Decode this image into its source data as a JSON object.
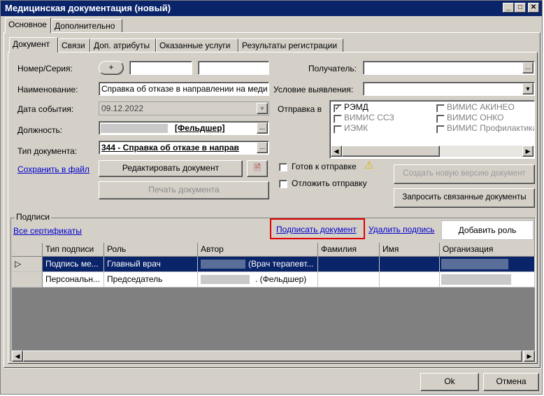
{
  "window": {
    "title": "Медицинская документация (новый)",
    "min_glyph": "_",
    "max_glyph": "□",
    "close_glyph": "✕"
  },
  "outer_tabs": [
    "Основное",
    "Дополнительно"
  ],
  "inner_tabs": [
    "Документ",
    "Связи",
    "Доп. атрибуты",
    "Оказанные услуги",
    "Результаты регистрации"
  ],
  "form": {
    "number_label": "Номер/Серия:",
    "plus_label": "+",
    "name_label": "Наименование:",
    "name_value": "Справка об отказе в направлении на меди",
    "event_date_label": "Дата события:",
    "event_date_value": "09.12.2022",
    "position_label": "Должность:",
    "position_value": "[Фельдшер]",
    "doc_type_label": "Тип документа:",
    "doc_type_value": "344 - Справка об отказе в направ",
    "recipient_label": "Получатель:",
    "condition_label": "Условие выявления:",
    "send_label": "Отправка в",
    "dots": "..."
  },
  "send_targets": [
    {
      "label": "РЭМД",
      "checked": true,
      "disabled": false
    },
    {
      "label": "ВИМИС ССЗ",
      "checked": false,
      "disabled": true
    },
    {
      "label": "ИЭМК",
      "checked": false,
      "disabled": true
    },
    {
      "label": "ВИМИС АКИНЕО",
      "checked": false,
      "disabled": true
    },
    {
      "label": "ВИМИС ОНКО",
      "checked": false,
      "disabled": true
    },
    {
      "label": "ВИМИС Профилактика",
      "checked": false,
      "disabled": true
    }
  ],
  "actions": {
    "save_to_file": "Сохранить в файл",
    "edit_document": "Редактировать документ",
    "print_document": "Печать документа",
    "ready_to_send": "Готов к отправке",
    "postpone_send": "Отложить отправку",
    "create_new_version": "Создать новую версию документ",
    "request_related": "Запросить связанные документы"
  },
  "signatures": {
    "group_label": "Подписи",
    "all_certificates": "Все сертификаты",
    "sign_document": "Подписать документ",
    "delete_signature": "Удалить подпись",
    "add_role": "Добавить роль",
    "columns": [
      "Тип подписи",
      "Роль",
      "Автор",
      "Фамилия",
      "Имя",
      "Организация"
    ],
    "rows": [
      {
        "marker": "▷",
        "type": "Подпись ме...",
        "role": "Главный врач",
        "author": "(Врач терапевт...",
        "last": "",
        "first": "",
        "org": ""
      },
      {
        "marker": "",
        "type": "Персональн...",
        "role": "Председатель",
        "author": ". (Фельдшер)",
        "last": "",
        "first": "",
        "org": ""
      }
    ]
  },
  "footer": {
    "ok": "Ok",
    "cancel": "Отмена"
  },
  "colors": {
    "title_bar": "#0a246a",
    "selected_row": "#0a246a",
    "highlight_border": "#e00000",
    "link": "#0000cc",
    "window_face": "#d4d0c8"
  }
}
